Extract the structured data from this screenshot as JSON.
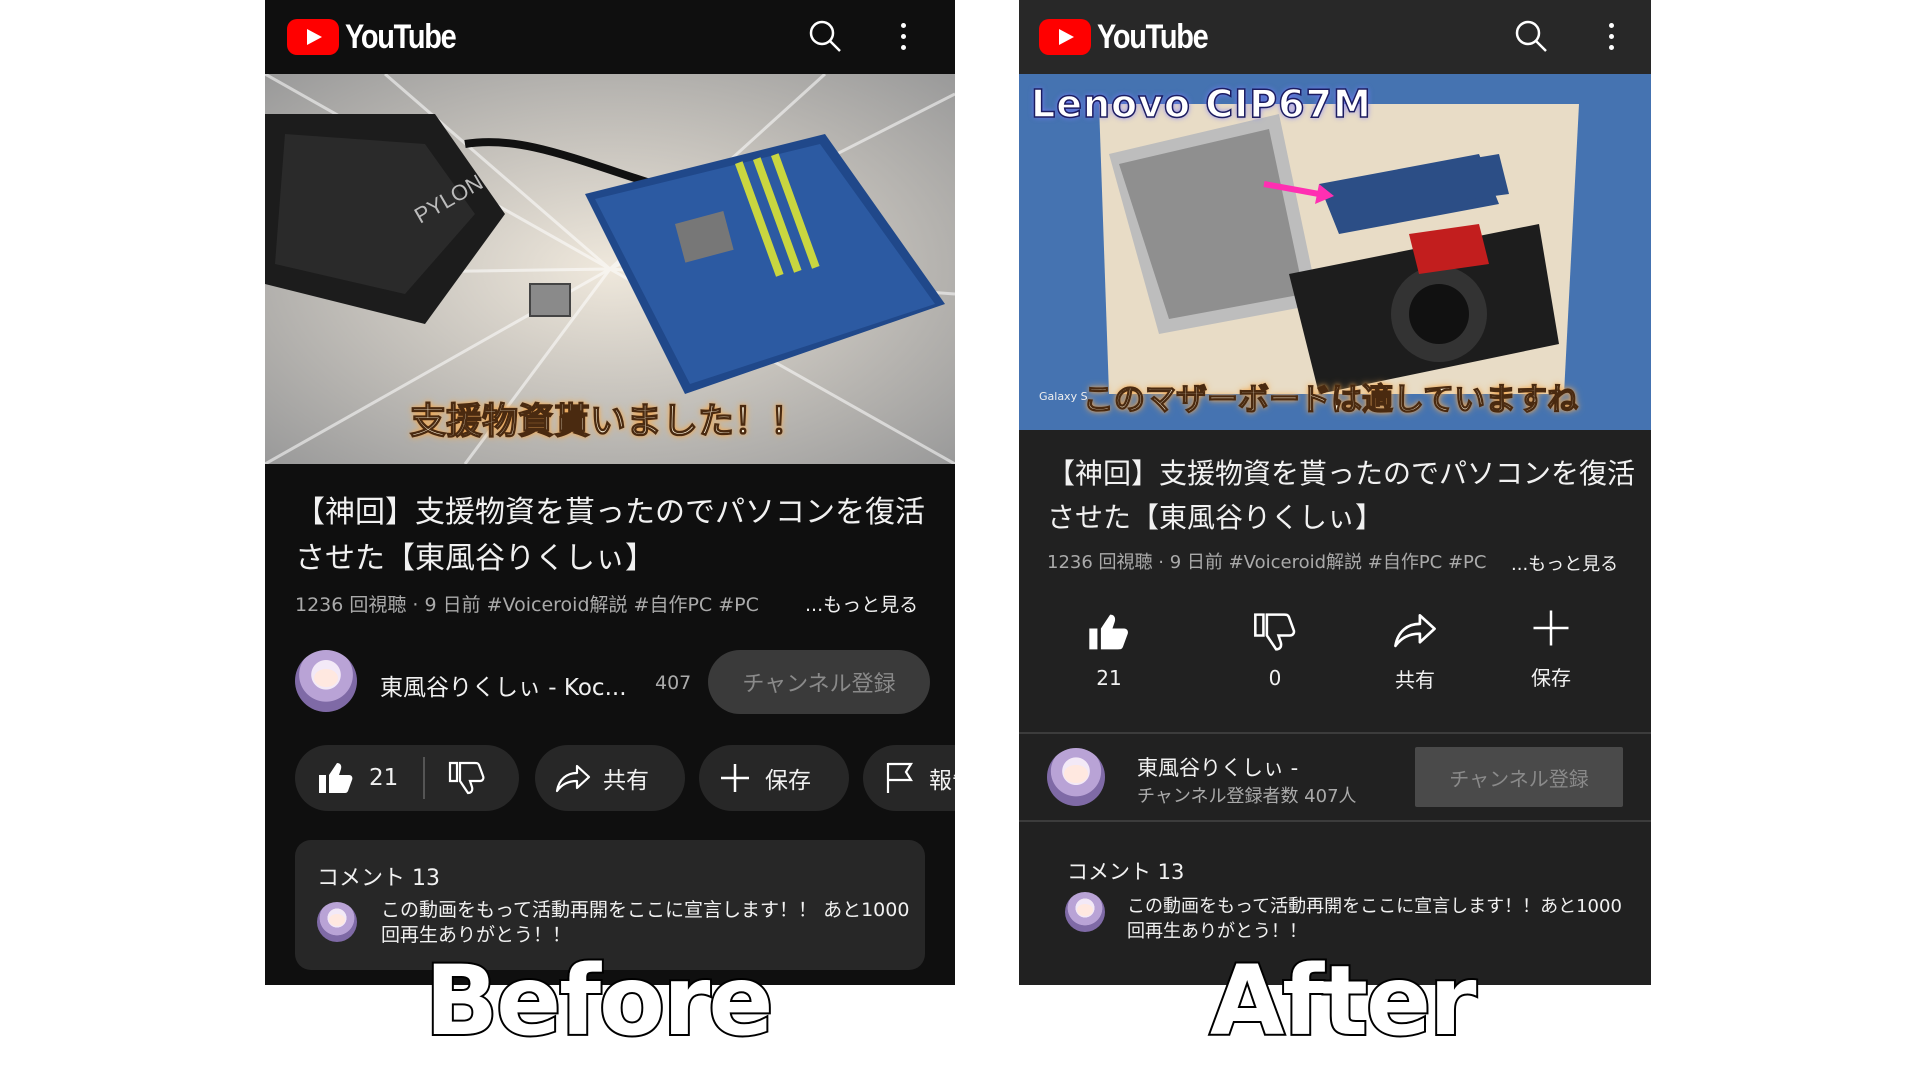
{
  "app_name": "YouTube",
  "labels": {
    "before": "Before",
    "after": "After"
  },
  "before": {
    "thumbnail_caption": "支援物資貰いました！！",
    "thumbnail_brand_text": "PYLON",
    "video_title": "【神回】支援物資を貰ったのでパソコンを復活させた【東風谷りくしぃ】",
    "meta": "1236 回視聴 · 9 日前   #Voiceroid解説 #自作PC #PC",
    "more": "...もっと見る",
    "channel_name": "東風谷りくしぃ - Koc...",
    "subscriber_count": "407",
    "subscribe_label": "チャンネル登録",
    "like_count": "21",
    "share_label": "共有",
    "save_label": "保存",
    "report_label": "報告",
    "comments_header": "コメント 13",
    "comment_text": "この動画をもって活動再開をここに宣言します！！ あと1000回再生ありがとう！！"
  },
  "after": {
    "thumbnail_title": "Lenovo CIP67M",
    "thumbnail_caption": "このマザーボードは適していますね",
    "thumbnail_watermark": "Galaxy S",
    "video_title": "【神回】支援物資を貰ったのでパソコンを復活させた【東風谷りくしぃ】",
    "meta": "1236 回視聴 · 9 日前   #Voiceroid解説 #自作PC #PC",
    "more": "...もっと見る",
    "like_count": "21",
    "dislike_count": "0",
    "share_label": "共有",
    "save_label": "保存",
    "channel_name": "東風谷りくしぃ -",
    "subscriber_text": "チャンネル登録者数 407人",
    "subscribe_label": "チャンネル登録",
    "comments_header": "コメント 13",
    "comment_text": "この動画をもって活動再開をここに宣言します！！あと1000回再生ありがとう！！"
  },
  "colors": {
    "brand_red": "#ff0000",
    "dark_bg": "#0f0f0f",
    "pill_bg": "#272727"
  }
}
